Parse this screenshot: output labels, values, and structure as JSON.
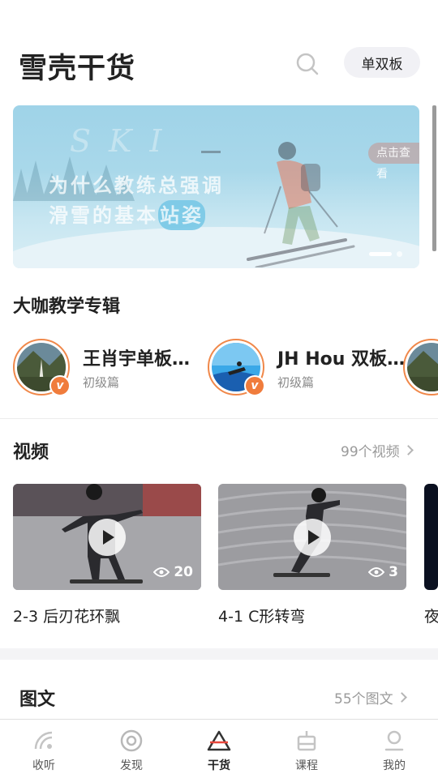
{
  "header": {
    "title": "雪壳干货",
    "segment_label": "单双板"
  },
  "banner": {
    "watermark": "SKI",
    "line1": "为什么教练总强调",
    "line2_prefix": "滑雪的基本",
    "line2_highlight": "站姿",
    "cta": "点击查看"
  },
  "experts_section": {
    "title": "大咖教学专辑",
    "items": [
      {
        "name": "王肖宇单板…",
        "level": "初级篇",
        "badge": "v"
      },
      {
        "name": "JH Hou 双板…",
        "level": "初级篇",
        "badge": "v"
      }
    ]
  },
  "videos_section": {
    "title": "视频",
    "more": "99个视频",
    "items": [
      {
        "title": "2-3 后刃花环飘",
        "views": "20"
      },
      {
        "title": "4-1 C形转弯",
        "views": "3"
      },
      {
        "title": "夜"
      }
    ]
  },
  "articles_section": {
    "title": "图文",
    "more": "55个图文"
  },
  "tabbar": {
    "items": [
      {
        "label": "收听",
        "icon": "signal-icon"
      },
      {
        "label": "发现",
        "icon": "discover-icon"
      },
      {
        "label": "干货",
        "icon": "triangle-icon",
        "active": true
      },
      {
        "label": "课程",
        "icon": "lift-icon"
      },
      {
        "label": "我的",
        "icon": "profile-icon"
      }
    ]
  },
  "colors": {
    "accent": "#f07c3c",
    "active_tab_underline": "#e8473c"
  }
}
